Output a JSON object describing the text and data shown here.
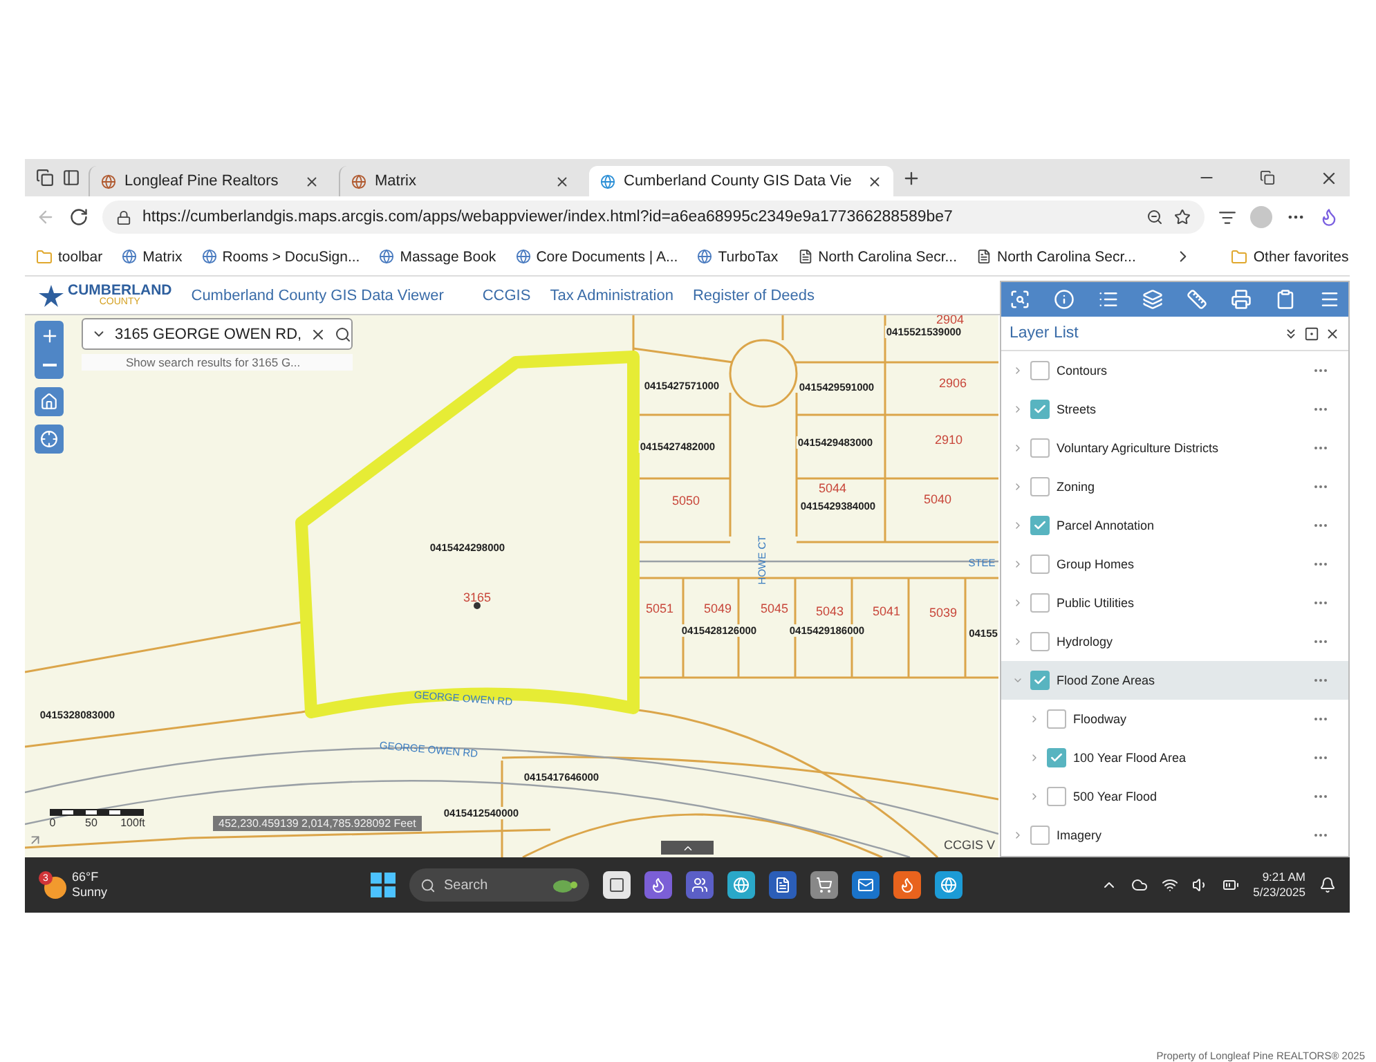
{
  "browser": {
    "tabs": [
      {
        "title": "Longleaf Pine Realtors",
        "selected": false
      },
      {
        "title": "Matrix",
        "selected": false
      },
      {
        "title": "Cumberland County GIS Data Vie",
        "selected": true
      }
    ],
    "url": "https://cumberlandgis.maps.arcgis.com/apps/webappviewer/index.html?id=a6ea68995c2349e9a177366288589be7",
    "bookmarks": [
      {
        "label": "toolbar",
        "kind": "folder"
      },
      {
        "label": "Matrix",
        "kind": "site"
      },
      {
        "label": "Rooms > DocuSign...",
        "kind": "site"
      },
      {
        "label": "Massage Book",
        "kind": "site"
      },
      {
        "label": "Core Documents | A...",
        "kind": "site"
      },
      {
        "label": "TurboTax",
        "kind": "site"
      },
      {
        "label": "North Carolina Secr...",
        "kind": "page"
      },
      {
        "label": "North Carolina Secr...",
        "kind": "page"
      }
    ],
    "other_favorites": "Other favorites"
  },
  "app_header": {
    "logo_text": "CUMBERLAND",
    "logo_subtext": "COUNTY",
    "title": "Cumberland County GIS Data Viewer",
    "links": [
      "CCGIS",
      "Tax Administration",
      "Register of Deeds"
    ]
  },
  "search": {
    "value": "3165 GEORGE OWEN RD,",
    "suggestion": "Show search results for 3165 G..."
  },
  "map": {
    "parcel_ids": [
      "0415521539000",
      "0415427571000",
      "0415429591000",
      "0415427482000",
      "0415429483000",
      "0415429384000",
      "0415424298000",
      "0415428126000",
      "0415429186000",
      "04155",
      "0415328083000",
      "0415417646000",
      "0415412540000"
    ],
    "addresses": [
      "2904",
      "2906",
      "2910",
      "5050",
      "5044",
      "5040",
      "3165",
      "5051",
      "5049",
      "5045",
      "5043",
      "5041",
      "5039"
    ],
    "streets": [
      "HOWE CT",
      "STEE",
      "GEORGE OWEN RD",
      "GEORGE OWEN RD"
    ],
    "scale_labels": [
      "0",
      "50",
      "100ft"
    ],
    "coordinates": "452,230.459139 2,014,785.928092 Feet",
    "attribution": "CCGIS V"
  },
  "layer_list": {
    "title": "Layer List",
    "layers": [
      {
        "name": "Contours",
        "checked": false,
        "expanded": false,
        "selected": false
      },
      {
        "name": "Streets",
        "checked": true,
        "expanded": false,
        "selected": false
      },
      {
        "name": "Voluntary Agriculture Districts",
        "checked": false,
        "expanded": false,
        "selected": false
      },
      {
        "name": "Zoning",
        "checked": false,
        "expanded": false,
        "selected": false
      },
      {
        "name": "Parcel Annotation",
        "checked": true,
        "expanded": false,
        "selected": false
      },
      {
        "name": "Group Homes",
        "checked": false,
        "expanded": false,
        "selected": false
      },
      {
        "name": "Public Utilities",
        "checked": false,
        "expanded": false,
        "selected": false
      },
      {
        "name": "Hydrology",
        "checked": false,
        "expanded": false,
        "selected": false
      },
      {
        "name": "Flood Zone Areas",
        "checked": true,
        "expanded": true,
        "selected": true,
        "children": [
          {
            "name": "Floodway",
            "checked": false,
            "expanded": false,
            "selected": false
          },
          {
            "name": "100 Year Flood Area",
            "checked": true,
            "expanded": false,
            "selected": false
          },
          {
            "name": "500 Year Flood",
            "checked": false,
            "expanded": false,
            "selected": false
          }
        ]
      },
      {
        "name": "Imagery",
        "checked": false,
        "expanded": false,
        "selected": false
      }
    ]
  },
  "taskbar": {
    "weather_badge": "3",
    "temperature": "66°F",
    "condition": "Sunny",
    "search_placeholder": "Search",
    "time": "9:21 AM",
    "date": "5/23/2025"
  },
  "footer": "Property of Longleaf Pine REALTORS®  2025"
}
